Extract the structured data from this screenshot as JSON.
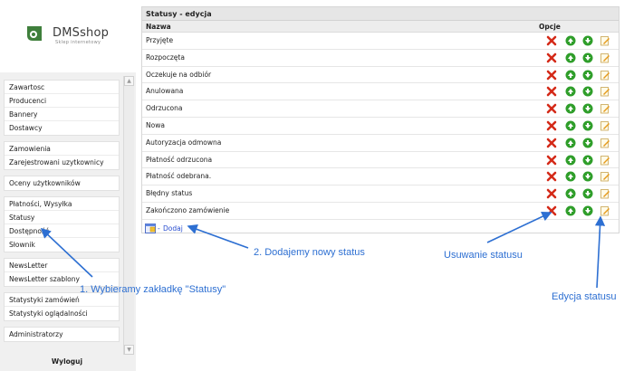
{
  "logo": {
    "name": "DMSshop",
    "tagline": "Sklep internetowy"
  },
  "menu": {
    "groups": [
      [
        "Zawartosc",
        "Producenci",
        "Bannery",
        "Dostawcy"
      ],
      [
        "Zamowienia",
        "Zarejestrowani uzytkownicy"
      ],
      [
        "Oceny użytkowników"
      ],
      [
        "Płatności, Wysyłka",
        "Statusy",
        "Dostępność",
        "Słownik"
      ],
      [
        "NewsLetter",
        "NewsLetter szablony"
      ],
      [
        "Statystyki zamówień",
        "Statystyki oglądalności"
      ],
      [
        "Administratorzy"
      ]
    ],
    "logout": "Wyloguj"
  },
  "panel": {
    "title": "Statusy - edycja",
    "col_name": "Nazwa",
    "col_options": "Opcje",
    "statuses": [
      "Przyjęte",
      "Rozpoczęta",
      "Oczekuje na odbiór",
      "Anulowana",
      "Odrzucona",
      "Nowa",
      "Autoryzacja odmowna",
      "Płatność odrzucona",
      "Płatność odebrana.",
      "Błędny status",
      "Zakończono zamówienie"
    ],
    "add_dash": "-",
    "add_label": "Dodaj"
  },
  "icons": {
    "delete": "delete-icon",
    "move_up": "arrow-up-icon",
    "move_down": "arrow-down-icon",
    "edit": "edit-icon",
    "add": "add-status-icon"
  },
  "annotations": {
    "step1": "1. Wybieramy zakładkę \"Statusy\"",
    "step2": "2. Dodajemy nowy status",
    "delete_note": "Usuwanie statusu",
    "edit_note": "Edycja statusu"
  },
  "colors": {
    "annotation": "#2d6fd2",
    "delete": "#d42a18",
    "move": "#2f9e2a",
    "link": "#2a4fd0"
  }
}
